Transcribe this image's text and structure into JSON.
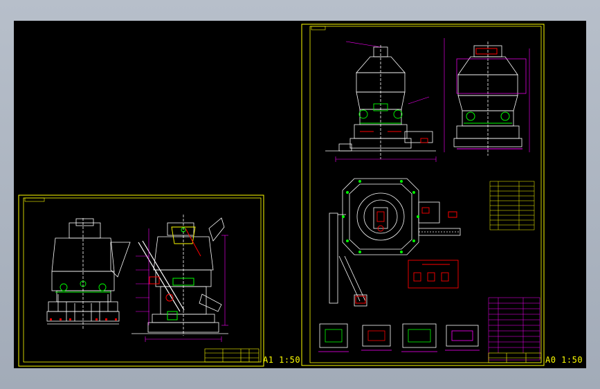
{
  "sheets": {
    "a1": {
      "scale_label": "A1 1:50"
    },
    "a0": {
      "scale_label": "A0 1:50"
    }
  },
  "colors": {
    "background": "#000000",
    "frame": "#ffff00",
    "geometry": "#ffffff",
    "dimensions": "#ff00ff",
    "accents": "#00ff00",
    "detail": "#ff0000",
    "window_chrome": "#b7bfca"
  }
}
